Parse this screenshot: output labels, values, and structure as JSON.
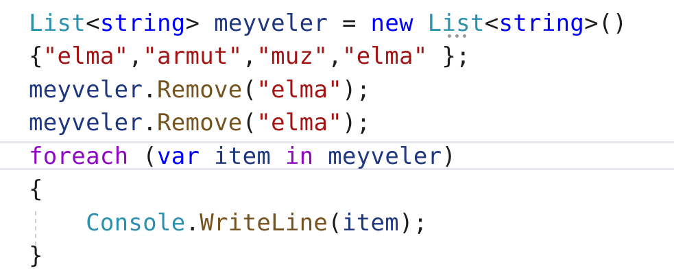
{
  "code": {
    "line1": {
      "list": "List",
      "lt": "<",
      "string": "string",
      "gt": ">",
      "sp1": " ",
      "var": "meyveler",
      "eq": " = ",
      "new": "new",
      "sp2": " ",
      "list2": "List",
      "lt2": "<",
      "string2": "string",
      "gt2": ">",
      "parens": "()"
    },
    "line2": {
      "open": "{",
      "s1": "\"elma\"",
      "c1": ",",
      "s2": "\"armut\"",
      "c2": ",",
      "s3": "\"muz\"",
      "c3": ",",
      "s4": "\"elma\"",
      "close": " };"
    },
    "line3": {
      "var": "meyveler",
      "dot": ".",
      "method": "Remove",
      "open": "(",
      "arg": "\"elma\"",
      "close": ");"
    },
    "line4": {
      "var": "meyveler",
      "dot": ".",
      "method": "Remove",
      "open": "(",
      "arg": "\"elma\"",
      "close": ");"
    },
    "line5": {
      "foreach": "foreach",
      "sp": " (",
      "var_kw": "var",
      "sp2": " ",
      "item": "item",
      "sp3": " ",
      "in": "in",
      "sp4": " ",
      "coll": "meyveler",
      "close": ")"
    },
    "line6": {
      "brace": "{"
    },
    "line7": {
      "indent": "    ",
      "console": "Console",
      "dot": ".",
      "method": "WriteLine",
      "open": "(",
      "arg": "item",
      "close": ");"
    },
    "line8": {
      "brace": "}"
    }
  },
  "colors": {
    "type": "#2b91af",
    "keyword": "#0000ff",
    "control_keyword": "#8f08c4",
    "identifier": "#1f377f",
    "string": "#a31515",
    "method": "#74531f"
  }
}
